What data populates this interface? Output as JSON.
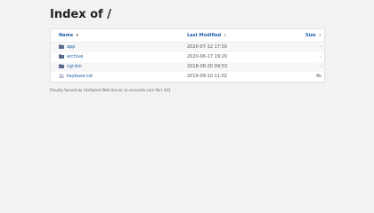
{
  "page": {
    "title": "Index of /"
  },
  "table": {
    "headers": {
      "name": "Name",
      "modified": "Last Modified",
      "size": "Size"
    },
    "rows": [
      {
        "name": "app",
        "modified": "2020-07-12 17:50",
        "size": "-",
        "icon": "folder-icon"
      },
      {
        "name": "archive",
        "modified": "2020-06-17 19:20",
        "size": "-",
        "icon": "folder-icon"
      },
      {
        "name": "cgi-bin",
        "modified": "2018-08-20 09:53",
        "size": "-",
        "icon": "folder-icon"
      },
      {
        "name": "keybase.txt",
        "modified": "2019-09-10 11:02",
        "size": "4k",
        "icon": "file-icon"
      }
    ]
  },
  "footer": {
    "text": "Proudly Served by LiteSpeed Web Server at cornoutle.com Port 443"
  },
  "colors": {
    "link": "#1f5fa8",
    "folder": "#5b6b8c",
    "background": "#f2f2f2"
  }
}
